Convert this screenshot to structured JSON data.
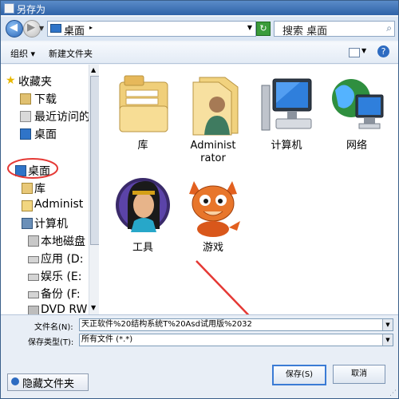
{
  "window": {
    "title": "另存为"
  },
  "address": {
    "path": "桌面",
    "search_placeholder": "搜索 桌面"
  },
  "toolbar": {
    "organize": "组织",
    "new_folder": "新建文件夹"
  },
  "sidebar": {
    "favorites": "收藏夹",
    "items": [
      {
        "label": "下载",
        "icon": "download-folder-icon"
      },
      {
        "label": "最近访问的",
        "icon": "recent-places-icon"
      },
      {
        "label": "桌面",
        "icon": "desktop-icon"
      }
    ],
    "tree": [
      {
        "label": "桌面",
        "icon": "desktop-icon"
      },
      {
        "label": "库",
        "icon": "library-icon"
      },
      {
        "label": "Administ",
        "icon": "user-icon"
      },
      {
        "label": "计算机",
        "icon": "computer-icon"
      },
      {
        "label": "本地磁盘",
        "icon": "local-disk-icon"
      },
      {
        "label": "应用 (D:",
        "icon": "drive-icon"
      },
      {
        "label": "娱乐 (E:",
        "icon": "drive-icon"
      },
      {
        "label": "备份 (F:",
        "icon": "drive-icon"
      },
      {
        "label": "DVD RW",
        "icon": "dvd-icon"
      }
    ]
  },
  "content": {
    "items": [
      {
        "label": "库",
        "icon": "libraries-folder-icon"
      },
      {
        "label": "Administ\nrator",
        "icon": "user-folder-icon"
      },
      {
        "label": "计算机",
        "icon": "computer-icon"
      },
      {
        "label": "网络",
        "icon": "network-icon"
      },
      {
        "label": "工具",
        "icon": "tools-avatar-icon"
      },
      {
        "label": "游戏",
        "icon": "games-dragon-icon"
      }
    ]
  },
  "form": {
    "filename_label": "文件名(N):",
    "filename_value": "天正软件%20结构系统T%20Asd试用版%2032",
    "filetype_label": "保存类型(T):",
    "filetype_value": "所有文件 (*.*)"
  },
  "buttons": {
    "hide_folders": "隐藏文件夹",
    "save": "保存(S)",
    "cancel": "取消"
  },
  "colors": {
    "accent": "#2d6bc1",
    "annotation": "#e53935"
  }
}
